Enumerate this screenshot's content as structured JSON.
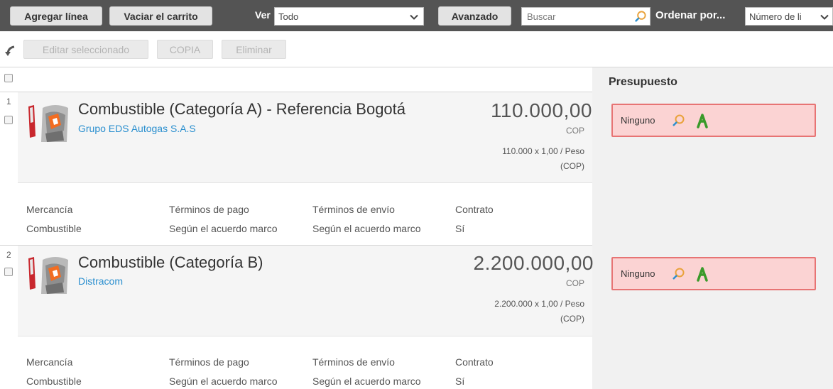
{
  "toolbar": {
    "add_line": "Agregar línea",
    "empty_cart": "Vaciar el carrito",
    "view_label": "Ver",
    "view_value": "Todo",
    "advanced": "Avanzado",
    "search_placeholder": "Buscar",
    "order_label": "Ordenar por...",
    "order_value": "Número de li"
  },
  "actions": {
    "edit_selected": "Editar seleccionado",
    "copy": "COPIA",
    "delete": "Eliminar"
  },
  "side": {
    "title": "Presupuesto"
  },
  "detail_headers": {
    "merchandise": "Mercancía",
    "payment_terms": "Términos de pago",
    "shipping_terms": "Términos de envío",
    "contract": "Contrato"
  },
  "items": [
    {
      "number": "1",
      "title": "Combustible (Categoría A) - Referencia Bogotá",
      "supplier": "Grupo EDS Autogas S.A.S",
      "price": "110.000,00",
      "currency": "COP",
      "calc_line1": "110.000 x 1,00 / Peso",
      "calc_line2": "(COP)",
      "merchandise": "Combustible",
      "payment_terms": "Según el acuerdo marco",
      "shipping_terms": "Según el acuerdo marco",
      "contract": "Sí",
      "budget": "Ninguno"
    },
    {
      "number": "2",
      "title": "Combustible (Categoría B)",
      "supplier": "Distracom",
      "price": "2.200.000,00",
      "currency": "COP",
      "calc_line1": "2.200.000 x 1,00 / Peso",
      "calc_line2": "(COP)",
      "merchandise": "Combustible",
      "payment_terms": "Según el acuerdo marco",
      "shipping_terms": "Según el acuerdo marco",
      "contract": "Sí",
      "budget": "Ninguno"
    }
  ],
  "icons": {
    "search": "magnifier-icon",
    "tree": "budget-tree-icon",
    "chevron": "chevron-down-icon",
    "back": "back-arrow-icon"
  },
  "colors": {
    "toolbar_bg": "#545454",
    "link": "#2a8fcf",
    "budget_bg": "#fbd3d3",
    "budget_border": "#e77474",
    "tree_icon": "#3a9a2a",
    "search_icon": "#e9a23b"
  }
}
